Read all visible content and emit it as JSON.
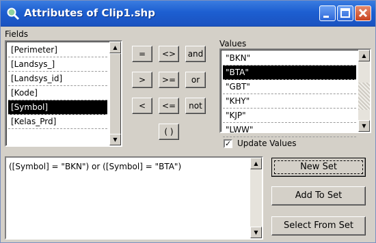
{
  "window": {
    "title": "Attributes of Clip1.shp"
  },
  "fields": {
    "label": "Fields",
    "items": [
      "[Perimeter]",
      "[Landsys_]",
      "[Landsys_id]",
      "[Kode]",
      "[Symbol]",
      "[Kelas_Prd]"
    ],
    "selected_index": 4
  },
  "operators": [
    "=",
    "<>",
    "and",
    ">",
    ">=",
    "or",
    "<",
    "<=",
    "not",
    "( )"
  ],
  "values": {
    "label": "Values",
    "items": [
      "\"BKN\"",
      "\"BTA\"",
      "\"GBT\"",
      "\"KHY\"",
      "\"KJP\"",
      "\"LWW\""
    ],
    "selected_index": 1
  },
  "update_values": {
    "label": "Update Values",
    "checked": true,
    "mark": "✓"
  },
  "expression": {
    "text": "([Symbol] = \"BKN\") or ([Symbol] = \"BTA\")"
  },
  "buttons": {
    "new_set": "New Set",
    "add_to_set": "Add To Set",
    "select_from_set": "Select From Set"
  },
  "icons": {
    "title": "zoom-magnifier-icon",
    "minimize": "minimize-icon",
    "maximize": "maximize-icon",
    "close": "close-icon"
  }
}
